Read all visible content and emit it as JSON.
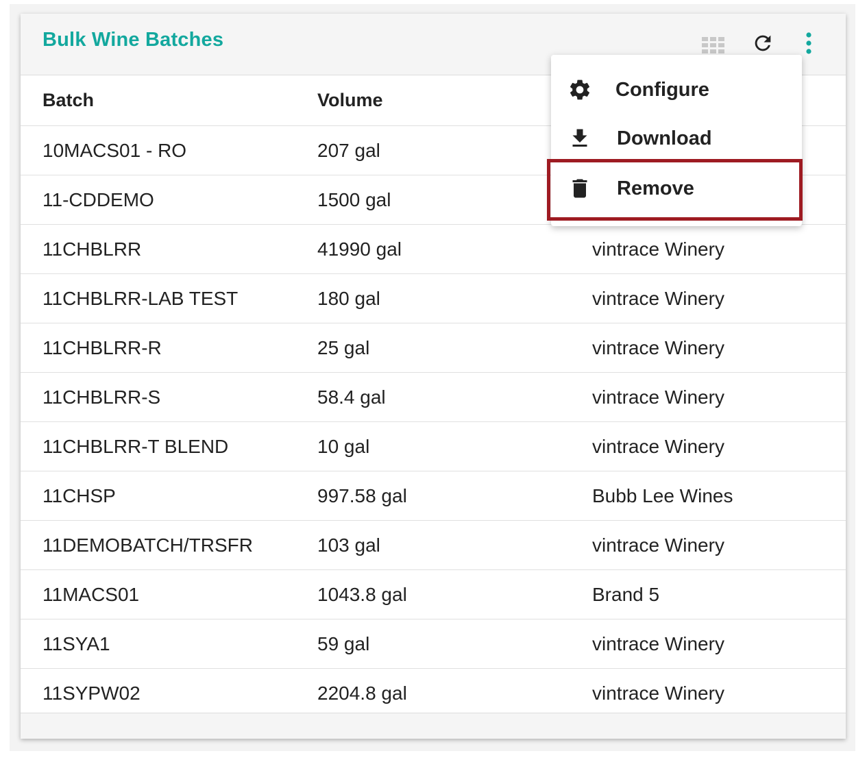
{
  "card": {
    "title": "Bulk Wine Batches",
    "title_color": "#13a89e"
  },
  "header_icons": [
    "grid-icon",
    "refresh-icon",
    "kebab-menu-icon"
  ],
  "table": {
    "columns": [
      "Batch",
      "Volume",
      ""
    ],
    "rows": [
      {
        "batch": "10MACS01 - RO",
        "volume": "207 gal",
        "owner": ""
      },
      {
        "batch": "11-CDDEMO",
        "volume": "1500 gal",
        "owner": ""
      },
      {
        "batch": "11CHBLRR",
        "volume": "41990 gal",
        "owner": "vintrace Winery"
      },
      {
        "batch": "11CHBLRR-LAB TEST",
        "volume": "180 gal",
        "owner": "vintrace Winery"
      },
      {
        "batch": "11CHBLRR-R",
        "volume": "25 gal",
        "owner": "vintrace Winery"
      },
      {
        "batch": "11CHBLRR-S",
        "volume": "58.4 gal",
        "owner": "vintrace Winery"
      },
      {
        "batch": "11CHBLRR-T BLEND",
        "volume": "10 gal",
        "owner": "vintrace Winery"
      },
      {
        "batch": "11CHSP",
        "volume": "997.58 gal",
        "owner": "Bubb Lee Wines"
      },
      {
        "batch": "11DEMOBATCH/TRSFR",
        "volume": "103 gal",
        "owner": "vintrace Winery"
      },
      {
        "batch": "11MACS01",
        "volume": "1043.8 gal",
        "owner": "Brand 5"
      },
      {
        "batch": "11SYA1",
        "volume": "59 gal",
        "owner": "vintrace Winery"
      },
      {
        "batch": "11SYPW02",
        "volume": "2204.8 gal",
        "owner": "vintrace Winery"
      }
    ]
  },
  "menu": {
    "items": [
      {
        "label": "Configure",
        "icon": "gear-icon"
      },
      {
        "label": "Download",
        "icon": "download-icon"
      },
      {
        "label": "Remove",
        "icon": "trash-icon"
      }
    ],
    "highlighted_item": "Remove",
    "highlight_color": "#9e1b22"
  }
}
